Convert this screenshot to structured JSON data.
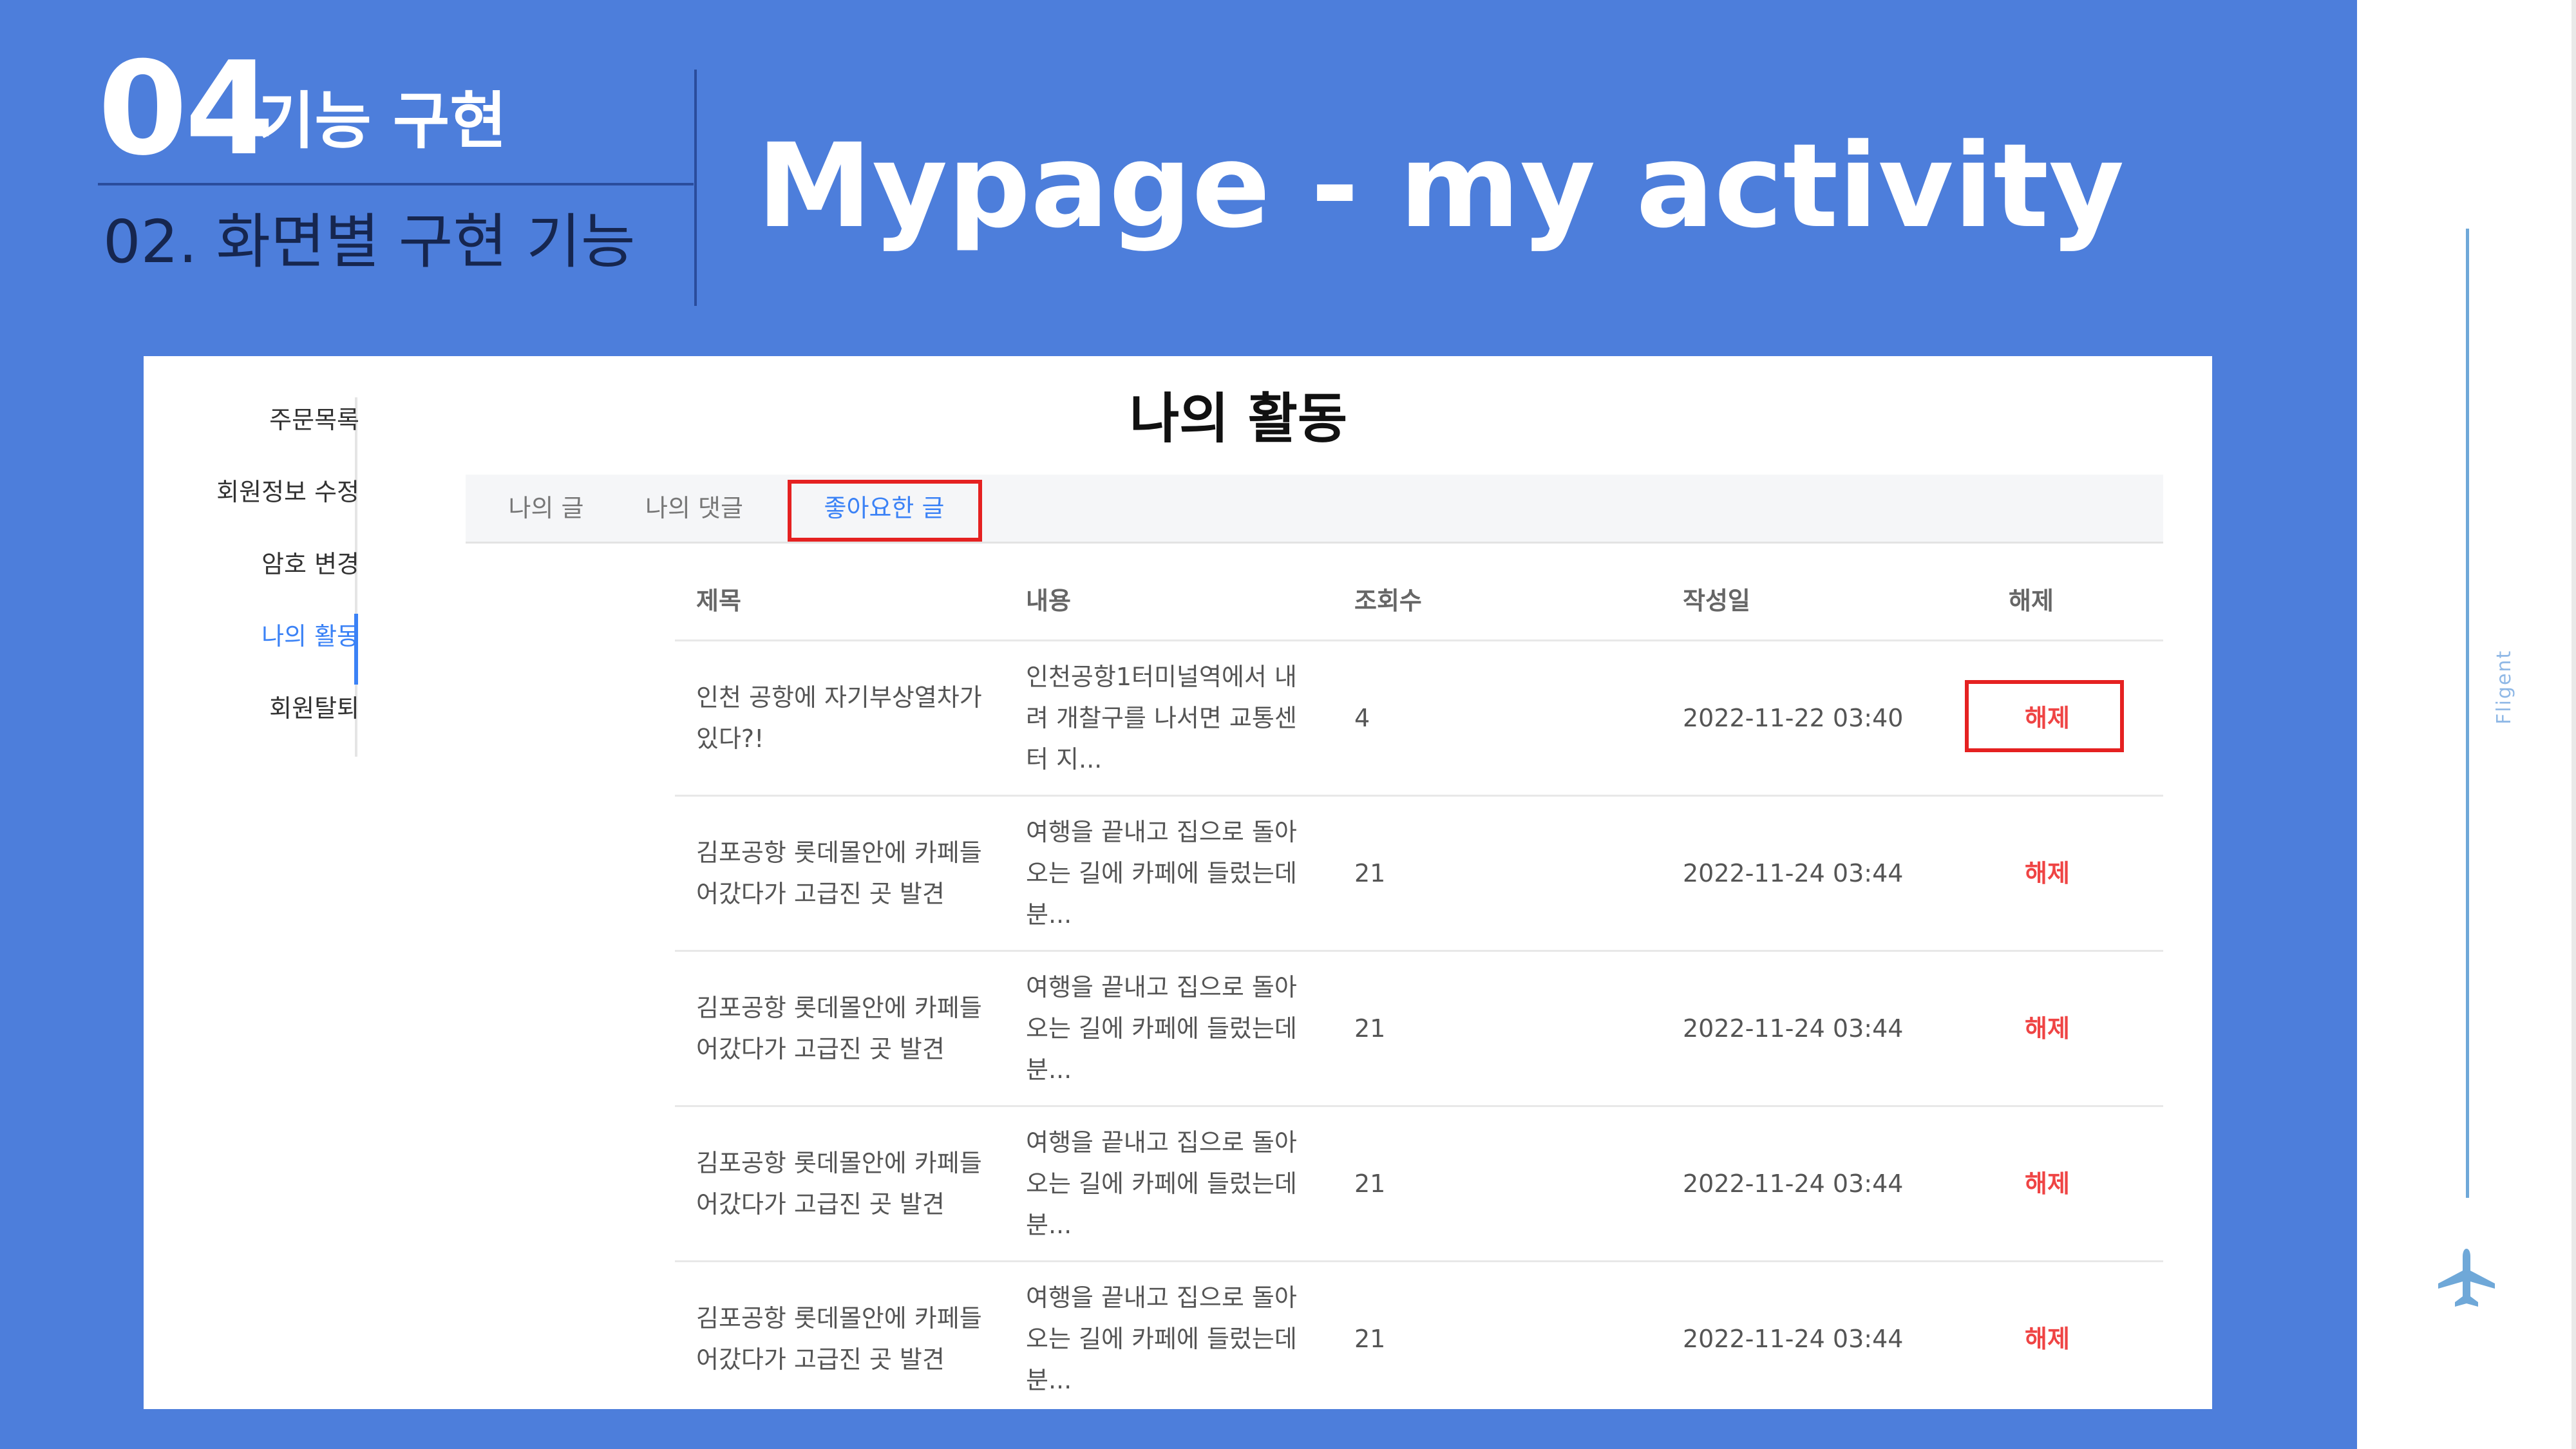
{
  "header": {
    "section_number": "04",
    "section_title": "기능 구현",
    "sub_title": "02. 화면별 구현 기능",
    "page_title": "Mypage - my activity"
  },
  "side_nav": {
    "items": [
      {
        "label": "주문목록",
        "active": false
      },
      {
        "label": "회원정보 수정",
        "active": false
      },
      {
        "label": "암호 변경",
        "active": false
      },
      {
        "label": "나의 활동",
        "active": true
      },
      {
        "label": "회원탈퇴",
        "active": false
      }
    ]
  },
  "main": {
    "title": "나의 활동",
    "tabs": [
      {
        "label": "나의 글",
        "selected": false
      },
      {
        "label": "나의 댓글",
        "selected": false
      },
      {
        "label": "좋아요한 글",
        "selected": true
      }
    ],
    "table": {
      "columns": [
        "제목",
        "내용",
        "조회수",
        "작성일",
        "해제"
      ],
      "rows": [
        {
          "title": "인천 공항에 자기부상열차가 있다?!",
          "content": "인천공항1터미널역에서 내려 개찰구를 나서면 교통센터 지...",
          "views": "4",
          "date": "2022-11-22 03:40",
          "action": "해제"
        },
        {
          "title": "김포공항 롯데몰안에 카페들어갔다가 고급진 곳 발견",
          "content": "여행을 끝내고 집으로 돌아오는 길에 카페에 들렀는데 분...",
          "views": "21",
          "date": "2022-11-24 03:44",
          "action": "해제"
        },
        {
          "title": "김포공항 롯데몰안에 카페들어갔다가 고급진 곳 발견",
          "content": "여행을 끝내고 집으로 돌아오는 길에 카페에 들렀는데 분...",
          "views": "21",
          "date": "2022-11-24 03:44",
          "action": "해제"
        },
        {
          "title": "김포공항 롯데몰안에 카페들어갔다가 고급진 곳 발견",
          "content": "여행을 끝내고 집으로 돌아오는 길에 카페에 들렀는데 분...",
          "views": "21",
          "date": "2022-11-24 03:44",
          "action": "해제"
        },
        {
          "title": "김포공항 롯데몰안에 카페들어갔다가 고급진 곳 발견",
          "content": "여행을 끝내고 집으로 돌아오는 길에 카페에 들렀는데 분...",
          "views": "21",
          "date": "2022-11-24 03:44",
          "action": "해제"
        }
      ]
    }
  },
  "decor": {
    "brand": "Fligent",
    "icon": "airplane-icon"
  },
  "colors": {
    "slide_bg": "#4d7edb",
    "accent_blue": "#3b82f6",
    "highlight_red": "#e52121",
    "unlike_red": "#ef4444"
  }
}
